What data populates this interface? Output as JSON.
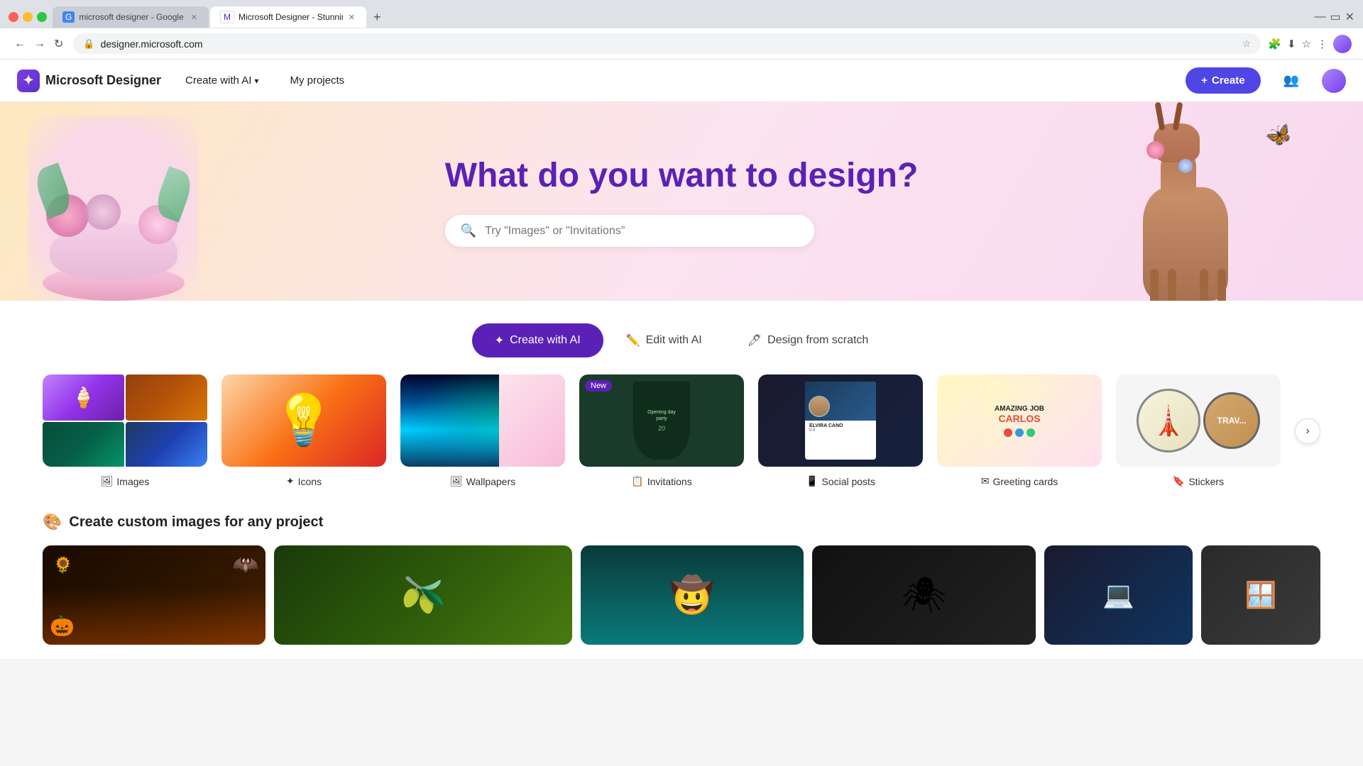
{
  "browser": {
    "tabs": [
      {
        "id": "tab1",
        "favicon": "G",
        "title": "microsoft designer - Google Se...",
        "active": false
      },
      {
        "id": "tab2",
        "favicon": "M",
        "title": "Microsoft Designer - Stunning ...",
        "active": true
      }
    ],
    "address": "designer.microsoft.com",
    "new_tab_label": "+",
    "nav": {
      "back": "←",
      "forward": "→",
      "refresh": "↻",
      "home": "⌂"
    }
  },
  "app": {
    "brand": {
      "name": "Microsoft Designer",
      "logo_symbol": "✦"
    },
    "nav": {
      "create_with_ai": "Create with AI",
      "my_projects": "My projects"
    },
    "create_btn": "+ Create",
    "share_icon": "👥",
    "user_icon": "👤"
  },
  "hero": {
    "title": "What do you want to design?",
    "search_placeholder": "Try \"Images\" or \"Invitations\""
  },
  "tabs": [
    {
      "id": "create-ai",
      "label": "Create with AI",
      "icon": "✦",
      "active": true
    },
    {
      "id": "edit-ai",
      "label": "Edit with AI",
      "icon": "✏️",
      "active": false
    },
    {
      "id": "design-scratch",
      "label": "Design from scratch",
      "icon": "🖊",
      "active": false
    }
  ],
  "categories": [
    {
      "id": "images",
      "label": "Images",
      "icon": "🖼",
      "new": false
    },
    {
      "id": "icons",
      "label": "Icons",
      "icon": "✦",
      "new": false
    },
    {
      "id": "wallpapers",
      "label": "Wallpapers",
      "icon": "🖼",
      "new": false
    },
    {
      "id": "invitations",
      "label": "Invitations",
      "icon": "📋",
      "new": true
    },
    {
      "id": "social-posts",
      "label": "Social posts",
      "icon": "📱",
      "new": false
    },
    {
      "id": "greeting-cards",
      "label": "Greeting cards",
      "icon": "✉",
      "new": false
    },
    {
      "id": "stickers",
      "label": "Stickers",
      "icon": "🔖",
      "new": false
    }
  ],
  "custom_section": {
    "icon": "🎨",
    "title": "Create custom images for any project"
  },
  "colors": {
    "primary": "#5b21b6",
    "create_btn": "#4f46e5"
  }
}
